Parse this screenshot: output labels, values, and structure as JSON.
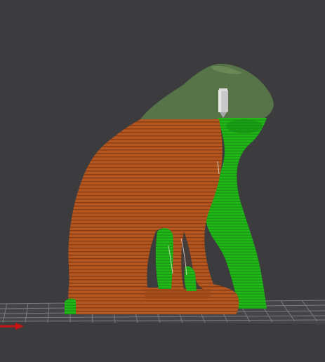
{
  "viewport": {
    "background_color": "#3c3c3e",
    "bed_grid_color": "#8a8a8e",
    "model_color": "#b4561f",
    "model_stripe_color": "#8a3d12",
    "support_color": "#22b81a",
    "support_dark_color": "#138a10",
    "preview_ghost_color": "#5a7a4a",
    "nozzle_color": "#c8c8c8",
    "x_axis_color": "#c81414"
  },
  "icons": [
    "nozzle-icon",
    "x-axis-arrow-icon"
  ]
}
